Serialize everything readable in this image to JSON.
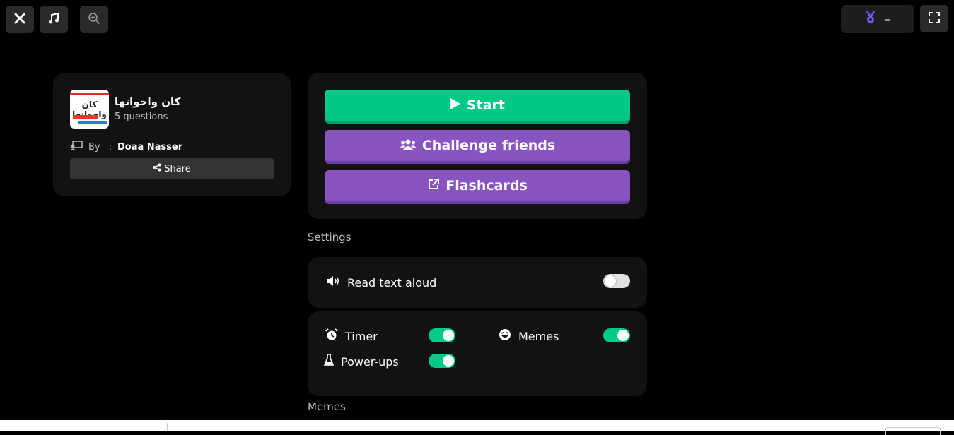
{
  "topbar": {
    "icons": {
      "close": "close-icon",
      "music": "music-icon",
      "zoom": "zoom-in-icon",
      "medal": "medal-icon",
      "fullscreen": "fullscreen-icon"
    },
    "medal_value": "–",
    "medal_color": "#6a5cf5"
  },
  "quiz": {
    "title": "كان واخواتها",
    "questions": "5 questions",
    "by_label": "By",
    "separator": ":",
    "author": "Doaa Nasser",
    "share_label": "Share",
    "thumbnail_text": "كان واخواتها"
  },
  "actions": {
    "start": "Start",
    "challenge": "Challenge friends",
    "flashcards": "Flashcards",
    "colors": {
      "green": "#00c985",
      "purple": "#8854c0"
    }
  },
  "settings": {
    "section_label": "Settings",
    "read_aloud": {
      "label": "Read text aloud",
      "on": false
    },
    "timer": {
      "label": "Timer",
      "on": true
    },
    "memes": {
      "label": "Memes",
      "on": true
    },
    "powerups": {
      "label": "Power-ups",
      "on": true
    }
  },
  "memes_section": {
    "label": "Memes"
  }
}
